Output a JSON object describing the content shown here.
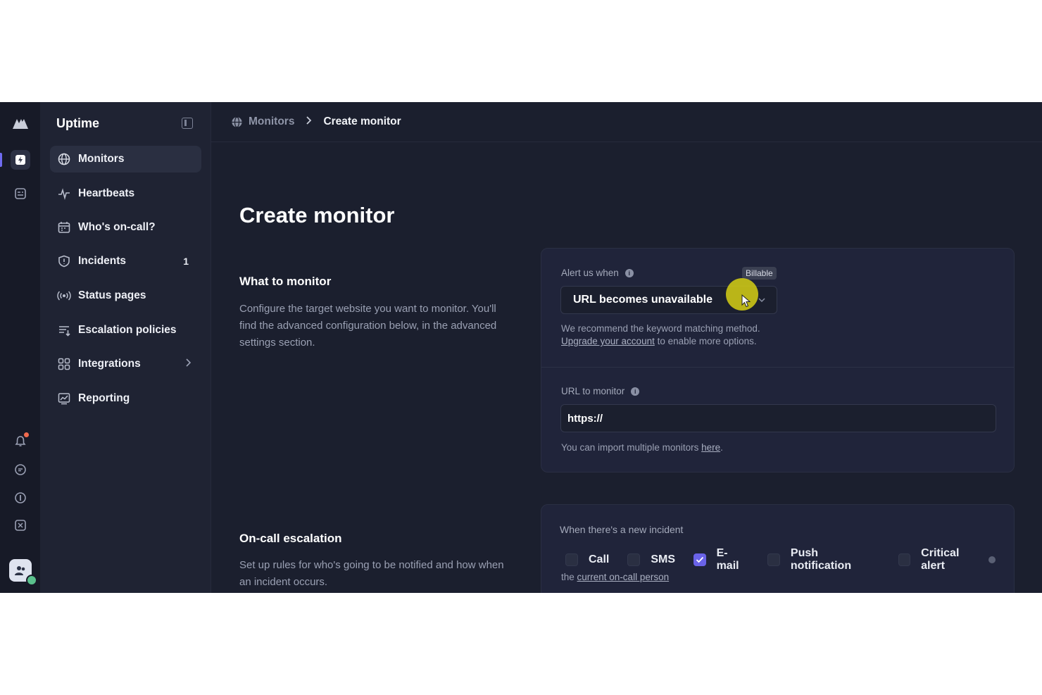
{
  "sidebar": {
    "title": "Uptime",
    "items": [
      {
        "label": "Monitors",
        "icon": "globe-icon"
      },
      {
        "label": "Heartbeats",
        "icon": "pulse-icon"
      },
      {
        "label": "Who's on-call?",
        "icon": "calendar-icon"
      },
      {
        "label": "Incidents",
        "icon": "shield-icon",
        "count": "1"
      },
      {
        "label": "Status pages",
        "icon": "broadcast-icon"
      },
      {
        "label": "Escalation policies",
        "icon": "list-icon"
      },
      {
        "label": "Integrations",
        "icon": "grid-icon"
      },
      {
        "label": "Reporting",
        "icon": "chart-icon"
      }
    ]
  },
  "breadcrumb": {
    "parent": "Monitors",
    "current": "Create monitor"
  },
  "page": {
    "title": "Create monitor",
    "what": {
      "heading": "What to monitor",
      "description": "Configure the target website you want to monitor. You'll find the advanced configuration below, in the advanced settings section."
    },
    "oncall": {
      "heading": "On-call escalation",
      "description": "Set up rules for who's going to be notified and how when an incident occurs."
    }
  },
  "alert": {
    "label": "Alert us when",
    "badge": "Billable",
    "selected": "URL becomes unavailable",
    "hint_line1": "We recommend the keyword matching method.",
    "hint_link": "Upgrade your account",
    "hint_line2_rest": " to enable more options."
  },
  "url": {
    "label": "URL to monitor",
    "value": "https://",
    "import_text": "You can import multiple monitors ",
    "import_link": "here",
    "import_end": "."
  },
  "incident": {
    "label": "When there's a new incident",
    "options": [
      {
        "label": "Call",
        "checked": false
      },
      {
        "label": "SMS",
        "checked": false
      },
      {
        "label": "E-mail",
        "checked": true
      },
      {
        "label": "Push notification",
        "checked": false
      },
      {
        "label": "Critical alert",
        "checked": false
      }
    ],
    "footer_prefix": "the ",
    "footer_link": "current on-call person"
  },
  "colors": {
    "accent": "#6a63e8",
    "background": "#1b1f2e",
    "card": "#20243a"
  }
}
